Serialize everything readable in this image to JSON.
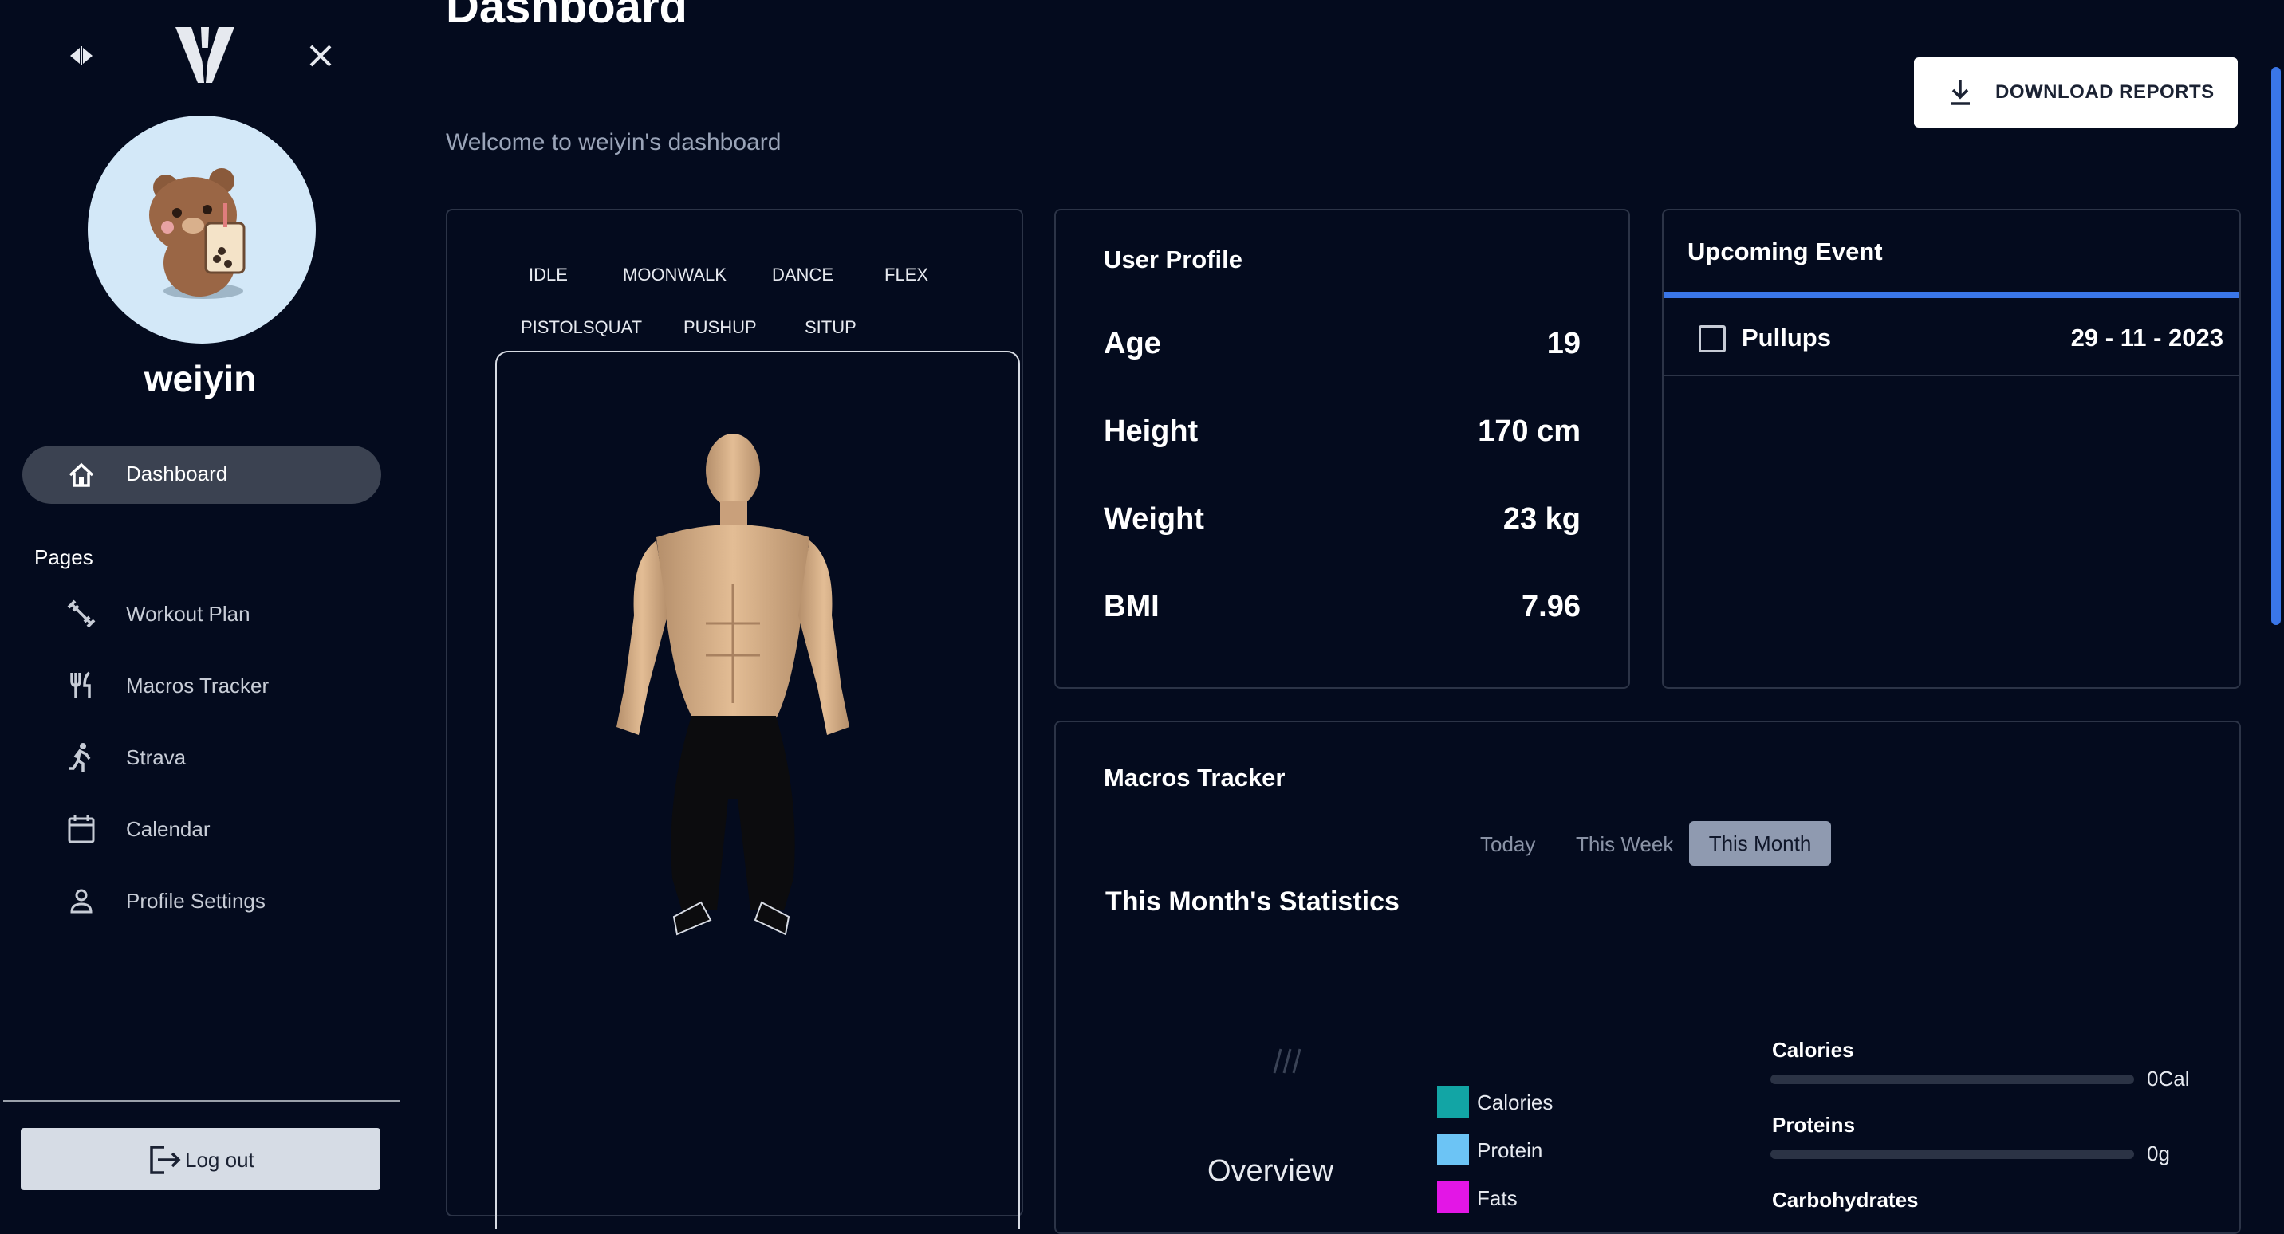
{
  "sidebar": {
    "username": "weiyin",
    "active_item": "Dashboard",
    "pages_title": "Pages",
    "items": [
      {
        "label": "Workout Plan",
        "icon": "dumbbell-icon"
      },
      {
        "label": "Macros Tracker",
        "icon": "utensils-icon"
      },
      {
        "label": "Strava",
        "icon": "running-icon"
      },
      {
        "label": "Calendar",
        "icon": "calendar-icon"
      },
      {
        "label": "Profile Settings",
        "icon": "person-icon"
      }
    ],
    "logout_label": "Log out"
  },
  "header": {
    "title": "Dashboard",
    "welcome": "Welcome to weiyin's dashboard",
    "download_label": "DOWNLOAD REPORTS"
  },
  "animations": [
    "IDLE",
    "MOONWALK",
    "DANCE",
    "FLEX",
    "PISTOLSQUAT",
    "PUSHUP",
    "SITUP"
  ],
  "profile": {
    "title": "User Profile",
    "rows": [
      {
        "label": "Age",
        "value": "19"
      },
      {
        "label": "Height",
        "value": "170 cm"
      },
      {
        "label": "Weight",
        "value": "23 kg"
      },
      {
        "label": "BMI",
        "value": "7.96"
      }
    ]
  },
  "events": {
    "title": "Upcoming Event",
    "items": [
      {
        "name": "Pullups",
        "date": "29 - 11 - 2023",
        "checked": false
      }
    ]
  },
  "macros": {
    "title": "Macros Tracker",
    "tabs": [
      "Today",
      "This Week",
      "This Month"
    ],
    "active_tab": "This Month",
    "stats_title": "This Month's Statistics",
    "overview_label": "Overview",
    "legend": [
      {
        "label": "Calories",
        "color": "#12a5a5"
      },
      {
        "label": "Protein",
        "color": "#6cc4f5"
      },
      {
        "label": "Fats",
        "color": "#e316e6"
      }
    ],
    "bars": [
      {
        "label": "Calories",
        "value": "0Cal",
        "fraction": 0
      },
      {
        "label": "Proteins",
        "value": "0g",
        "fraction": 0
      },
      {
        "label": "Carbohydrates",
        "value": "",
        "fraction": 0
      }
    ]
  }
}
